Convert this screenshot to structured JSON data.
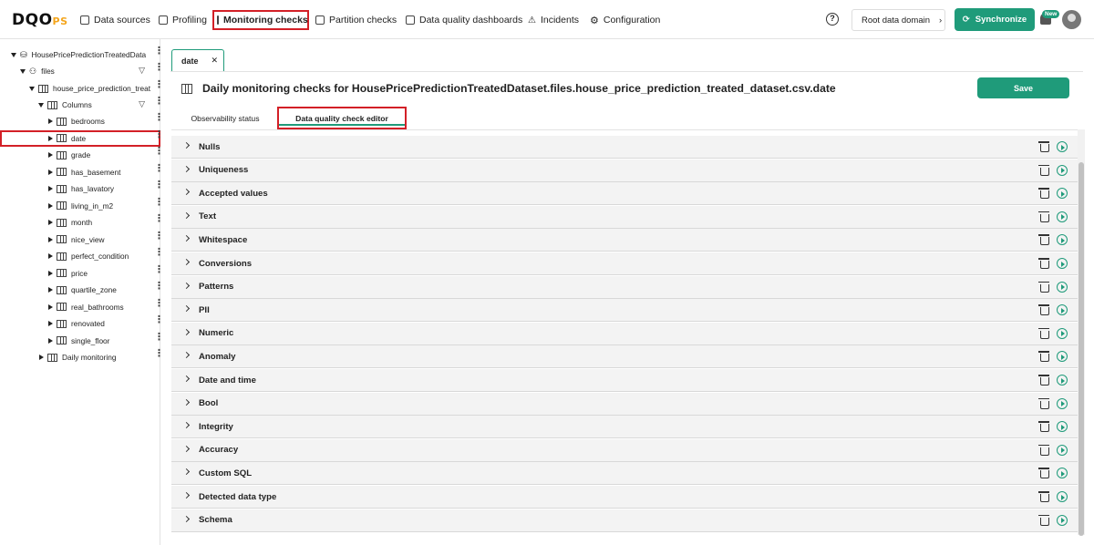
{
  "app": {
    "logo_main": "DQO",
    "logo_suffix": "PS"
  },
  "nav": {
    "items": [
      {
        "label": "Data sources",
        "icon": "database-icon"
      },
      {
        "label": "Profiling",
        "icon": "table-icon"
      },
      {
        "label": "Monitoring checks",
        "icon": "table-icon",
        "active": true
      },
      {
        "label": "Partition checks",
        "icon": "grid-icon"
      },
      {
        "label": "Data quality dashboards",
        "icon": "dashboard-icon"
      },
      {
        "label": "Incidents",
        "icon": "warning-icon"
      },
      {
        "label": "Configuration",
        "icon": "gear-icon"
      }
    ],
    "help": "?",
    "root_domain": "Root data domain",
    "synchronize": "Synchronize",
    "new_badge": "New"
  },
  "sidebar": {
    "connection": "HousePricePredictionTreatedData",
    "schema": "files",
    "table": "house_price_prediction_treat",
    "columns_label": "Columns",
    "columns": [
      "bedrooms",
      "date",
      "grade",
      "has_basement",
      "has_lavatory",
      "living_in_m2",
      "month",
      "nice_view",
      "perfect_condition",
      "price",
      "quartile_zone",
      "real_bathrooms",
      "renovated",
      "single_floor"
    ],
    "selected_column": "date",
    "daily_monitoring": "Daily monitoring"
  },
  "main": {
    "tab_label": "date",
    "tab_close": "✕",
    "title": "Daily monitoring checks for HousePricePredictionTreatedDataset.files.house_price_prediction_treated_dataset.csv.date",
    "save_label": "Save",
    "subtabs": [
      "Observability status",
      "Data quality check editor"
    ],
    "categories": [
      "Nulls",
      "Uniqueness",
      "Accepted values",
      "Text",
      "Whitespace",
      "Conversions",
      "Patterns",
      "PII",
      "Numeric",
      "Anomaly",
      "Date and time",
      "Bool",
      "Integrity",
      "Accuracy",
      "Custom SQL",
      "Detected data type",
      "Schema"
    ]
  },
  "colors": {
    "accent": "#1f9b7a",
    "highlight": "#d32027"
  }
}
